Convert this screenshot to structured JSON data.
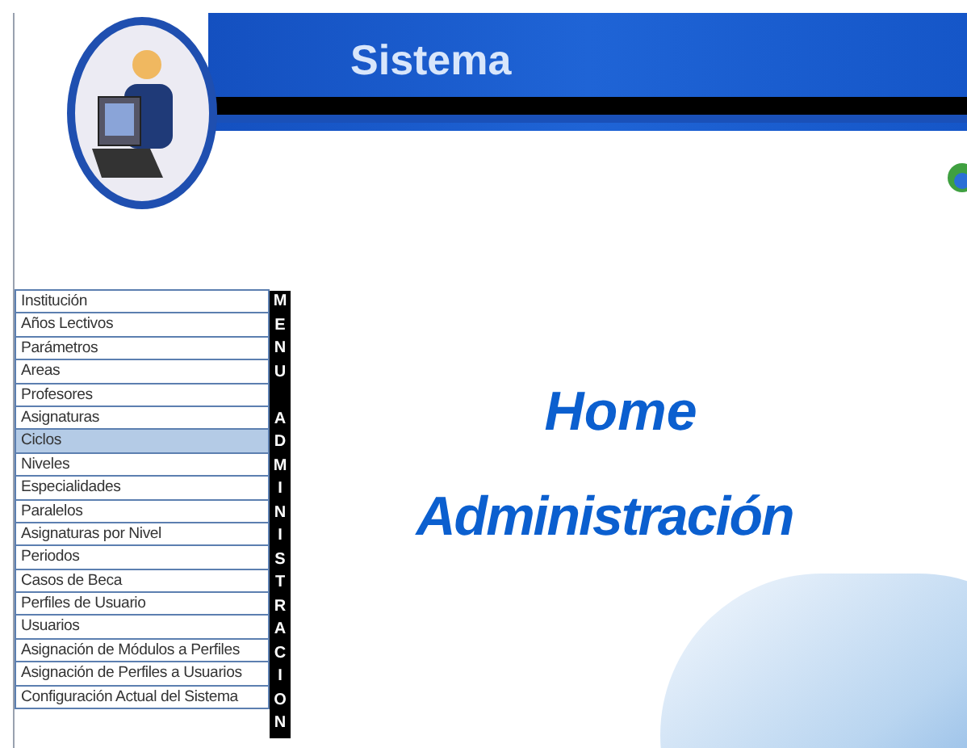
{
  "header": {
    "title": "Sistema"
  },
  "menu": {
    "label": "MENU ADMINISTRACION",
    "items": [
      {
        "label": "Institución",
        "selected": false
      },
      {
        "label": "Años Lectivos",
        "selected": false
      },
      {
        "label": "Parámetros",
        "selected": false
      },
      {
        "label": "Areas",
        "selected": false
      },
      {
        "label": "Profesores",
        "selected": false
      },
      {
        "label": "Asignaturas",
        "selected": false
      },
      {
        "label": "Ciclos",
        "selected": true
      },
      {
        "label": "Niveles",
        "selected": false
      },
      {
        "label": "Especialidades",
        "selected": false
      },
      {
        "label": "Paralelos",
        "selected": false
      },
      {
        "label": "Asignaturas por Nivel",
        "selected": false
      },
      {
        "label": "Periodos",
        "selected": false
      },
      {
        "label": "Casos de Beca",
        "selected": false
      },
      {
        "label": "Perfiles de Usuario",
        "selected": false
      },
      {
        "label": "Usuarios",
        "selected": false
      },
      {
        "label": "Asignación de Módulos a Perfiles",
        "selected": false
      },
      {
        "label": "Asignación de Perfiles a Usuarios",
        "selected": false
      },
      {
        "label": "Configuración Actual del Sistema",
        "selected": false
      }
    ]
  },
  "main": {
    "title": "Home",
    "subtitle": "Administración"
  }
}
